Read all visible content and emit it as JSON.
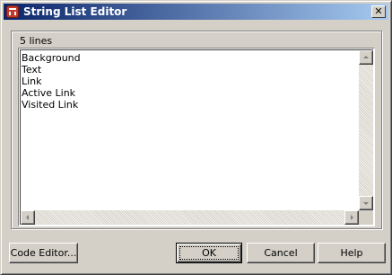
{
  "window": {
    "title": "String List Editor",
    "close_glyph": "✕"
  },
  "editor": {
    "line_count_label": "5 lines",
    "lines": [
      "Background",
      "Text",
      "Link",
      "Active Link",
      "Visited Link"
    ]
  },
  "buttons": {
    "code_editor": "Code Editor...",
    "ok": "OK",
    "cancel": "Cancel",
    "help": "Help"
  },
  "icons": {
    "app": "string-list-editor-app-icon",
    "scroll_up": "arrow-up-icon",
    "scroll_down": "arrow-down-icon",
    "scroll_left": "arrow-left-icon",
    "scroll_right": "arrow-right-icon"
  },
  "colors": {
    "titlebar_start": "#0a246a",
    "titlebar_end": "#a6caf0",
    "face": "#d4d0c8"
  }
}
